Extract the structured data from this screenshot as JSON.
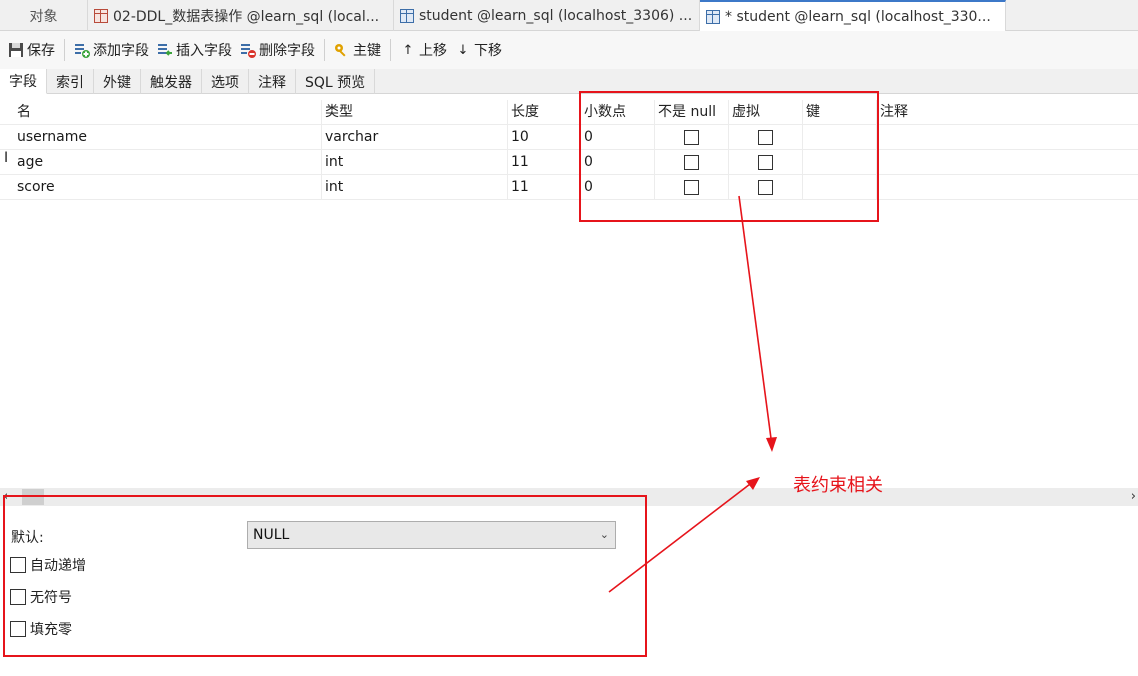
{
  "window_tabs": [
    {
      "label": "对象"
    },
    {
      "label": "02-DDL_数据表操作 @learn_sql (local..."
    },
    {
      "label": "student @learn_sql (localhost_3306) ..."
    },
    {
      "label": "* student @learn_sql (localhost_330..."
    }
  ],
  "toolbar": {
    "save": "保存",
    "add_field": "添加字段",
    "insert_field": "插入字段",
    "delete_field": "删除字段",
    "primary_key": "主键",
    "move_up": "上移",
    "move_down": "下移"
  },
  "sub_tabs": [
    {
      "label": "字段"
    },
    {
      "label": "索引"
    },
    {
      "label": "外键"
    },
    {
      "label": "触发器"
    },
    {
      "label": "选项"
    },
    {
      "label": "注释"
    },
    {
      "label": "SQL 预览"
    }
  ],
  "columns": {
    "name": "名",
    "type": "类型",
    "length": "长度",
    "decimals": "小数点",
    "not_null": "不是 null",
    "virtual": "虚拟",
    "key": "键",
    "comment": "注释"
  },
  "rows": [
    {
      "name": "username",
      "type": "varchar",
      "length": "10",
      "decimals": "0",
      "not_null": false,
      "virtual": false
    },
    {
      "name": "age",
      "type": "int",
      "length": "11",
      "decimals": "0",
      "not_null": false,
      "virtual": false
    },
    {
      "name": "score",
      "type": "int",
      "length": "11",
      "decimals": "0",
      "not_null": false,
      "virtual": false
    }
  ],
  "current_row_marker": "I",
  "properties": {
    "default_label": "默认:",
    "default_value": "NULL",
    "auto_increment": "自动递增",
    "unsigned": "无符号",
    "zerofill": "填充零"
  },
  "annotation": {
    "text": "表约束相关",
    "color": "#e6141b"
  }
}
